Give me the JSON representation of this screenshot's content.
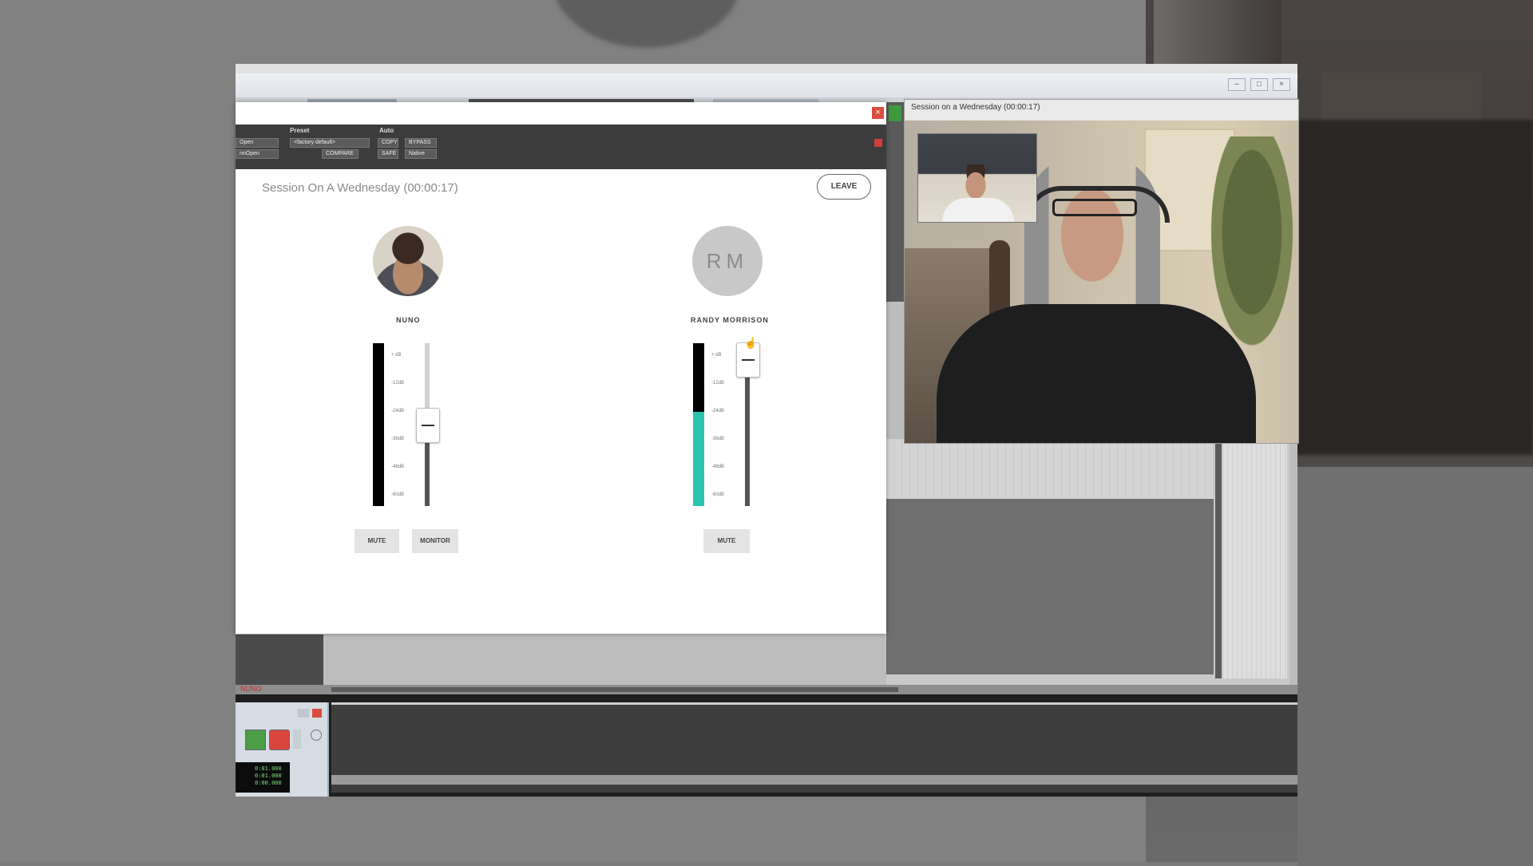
{
  "session": {
    "title": "Session On A Wednesday (00:00:17)",
    "leave_label": "LEAVE",
    "close_glyph": "×"
  },
  "plugin_header": {
    "preset_label": "Preset",
    "auto_label": "Auto",
    "preset_value": "<factory default>",
    "left_top": "Open",
    "left_bottom": "nnOpen",
    "compare_label": "COMPARE",
    "safe_label": "SAFE",
    "bypass_label": "BYPASS",
    "native_label": "Native",
    "copy_label": "COPY"
  },
  "participants": [
    {
      "name": "NUNO",
      "avatar": "photo",
      "meter_level": 0,
      "fader_level": 0.5,
      "scale": [
        "+ dB",
        "-12dB",
        "-24dB",
        "-36dB",
        "-48dB",
        "-60dB"
      ],
      "buttons": [
        "MUTE",
        "MONITOR"
      ]
    },
    {
      "name": "RANDY MORRISON",
      "initials": "RM",
      "meter_level": 0.58,
      "fader_level": 0.9,
      "scale": [
        "+ dB",
        "-12dB",
        "-24dB",
        "-36dB",
        "-48dB",
        "-60dB"
      ],
      "buttons": [
        "MUTE"
      ]
    }
  ],
  "video": {
    "title": "Session on a Wednesday (00:00:17)"
  },
  "daw": {
    "track_label": "NUNO",
    "timecode": [
      "0:01.000",
      "0:01.000",
      "0:00.000"
    ]
  },
  "colors": {
    "meter_fill": "#2bc4ae",
    "close_red": "#d84d3d",
    "record_red": "#d9463d",
    "play_green": "#3f9a3f"
  }
}
